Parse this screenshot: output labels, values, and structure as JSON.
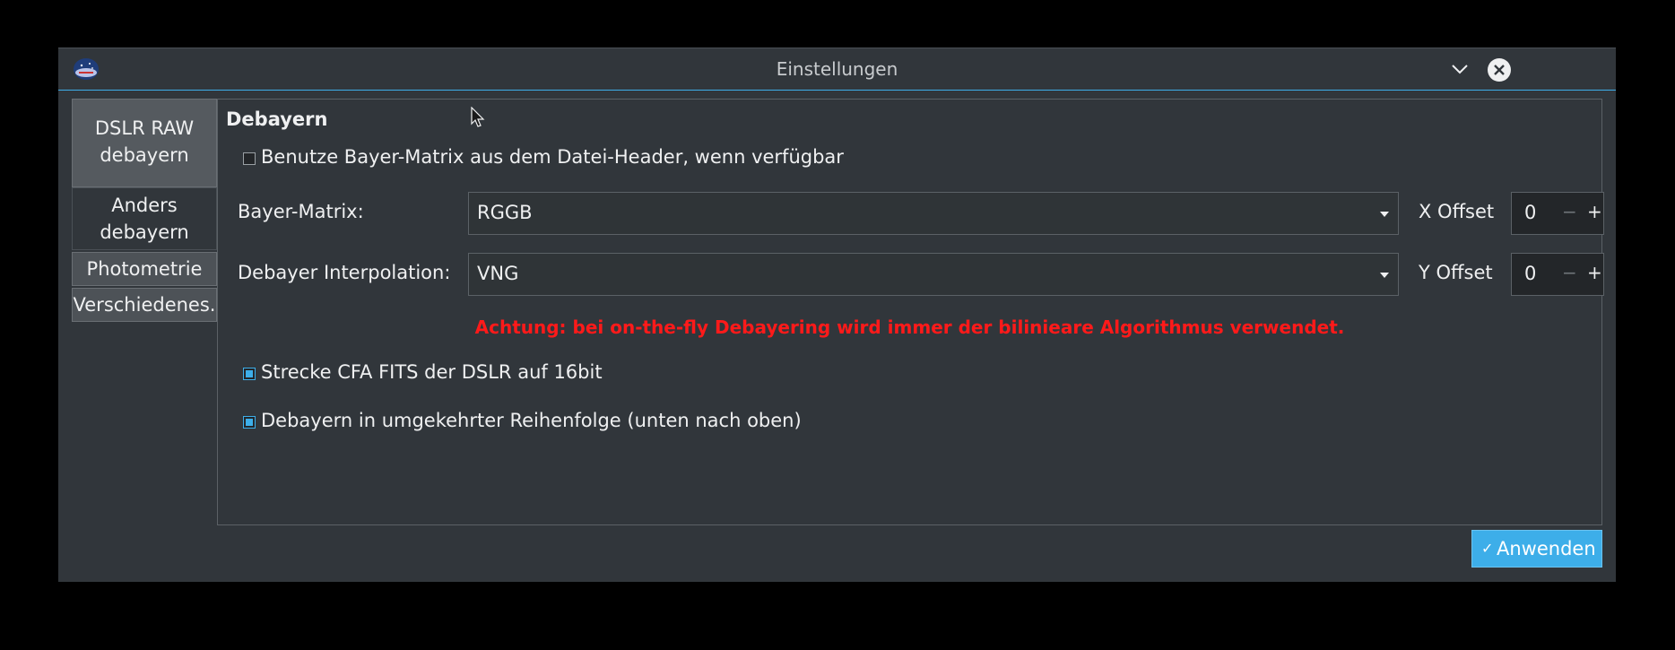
{
  "window": {
    "title": "Einstellungen"
  },
  "sidebar": {
    "items": [
      {
        "label_line1": "DSLR RAW",
        "label_line2": "debayern"
      },
      {
        "label_line1": "Anders",
        "label_line2": "debayern"
      },
      {
        "label": "Photometrie"
      },
      {
        "label": "Verschiedenes."
      }
    ]
  },
  "panel": {
    "title": "Debayern",
    "use_header_matrix_label": "Benutze Bayer-Matrix aus dem Datei-Header, wenn verfügbar",
    "bayer_matrix_label": "Bayer-Matrix:",
    "bayer_matrix_value": "RGGB",
    "x_offset_label": "X Offset",
    "x_offset_value": "0",
    "interpolation_label": "Debayer Interpolation:",
    "interpolation_value": "VNG",
    "y_offset_label": "Y Offset",
    "y_offset_value": "0",
    "spin_minus": "−",
    "spin_plus": "+",
    "warning": "Achtung: bei on-the-fly Debayering wird immer der bilinieare Algorithmus verwendet.",
    "stretch_cfa_label": "Strecke CFA FITS der DSLR auf 16bit",
    "reverse_order_label": "Debayern in umgekehrter Reihenfolge (unten nach oben)"
  },
  "apply_button": {
    "label": "Anwenden"
  },
  "colors": {
    "accent": "#3daee9",
    "window_bg": "#31363b",
    "warning": "#ff1a1a"
  }
}
